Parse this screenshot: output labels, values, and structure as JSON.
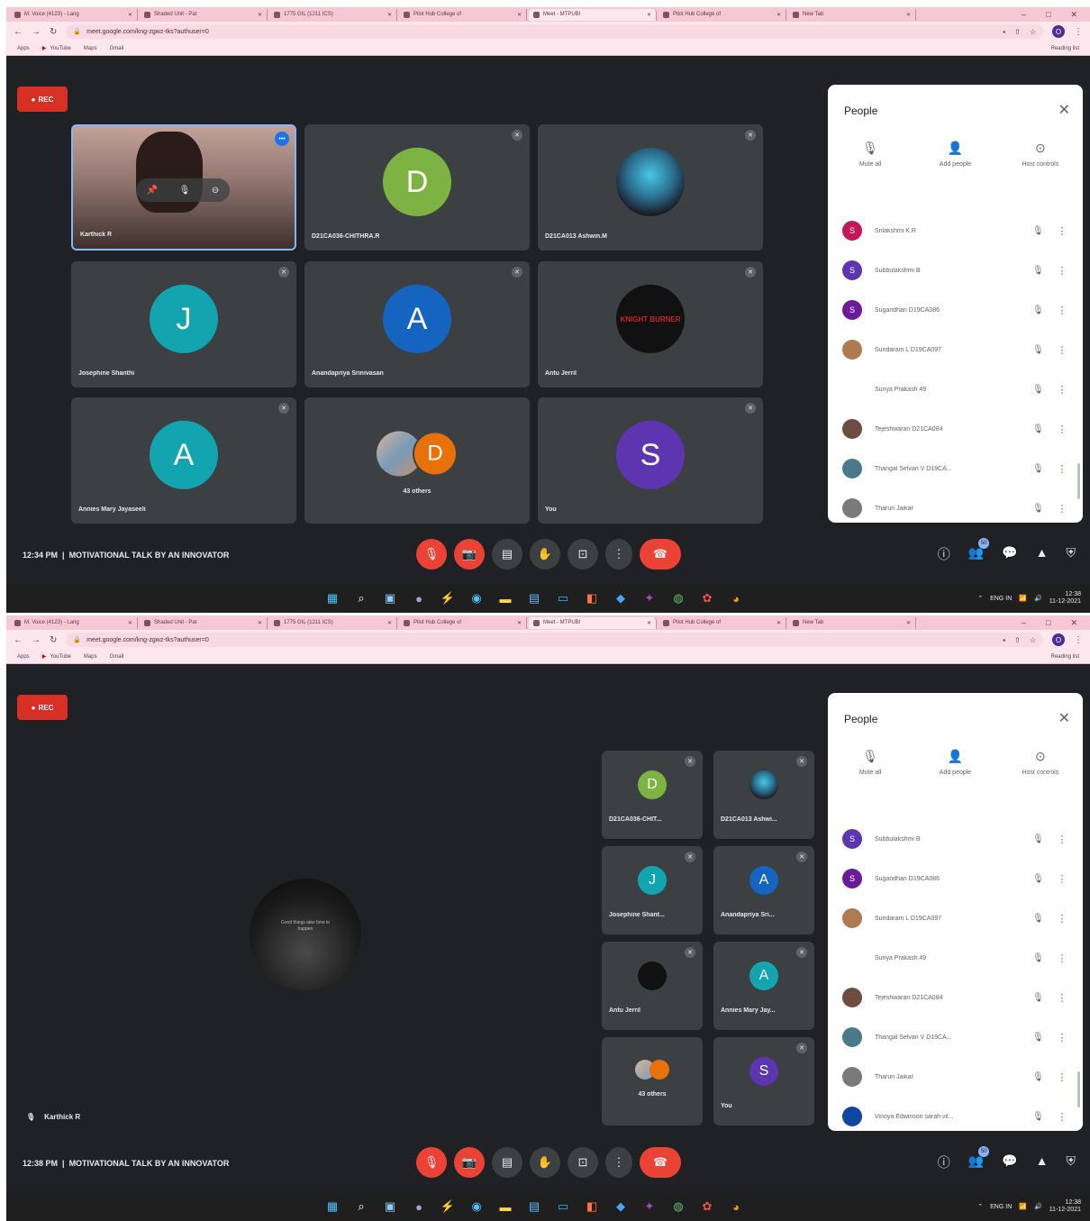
{
  "browser": {
    "tabs": [
      "M. Voice (4123) - Lang",
      "Shaded Unit - Pat",
      "1775 GIL (1211 ICS)",
      "Pilot Hub College of",
      "Meet - MTPUBI",
      "Pilot Hub College of",
      "New Tab"
    ],
    "active_tab_index": 4,
    "url": "meet.google.com/kng-zgwz-tks?authuser=0",
    "profile_initial": "O",
    "bookmarks": [
      "Apps",
      "YouTube",
      "Maps",
      "Gmail"
    ],
    "reading_list": "Reading list",
    "window_controls": [
      "–",
      "□",
      "✕"
    ]
  },
  "meet": {
    "rec_label": "REC",
    "shot1": {
      "time": "12:34 PM",
      "meeting_title": "MOTIVATIONAL TALK BY AN INNOVATOR",
      "tiles": [
        {
          "name": "Karthick R",
          "type": "self"
        },
        {
          "name": "D21CA036-CHITHRA.R",
          "initial": "D",
          "color": "#7cb342"
        },
        {
          "name": "D21CA013 Ashwin.M",
          "type": "photo"
        },
        {
          "name": "Josephine Shanthi",
          "initial": "J",
          "color": "#12a4af"
        },
        {
          "name": "Anandapriya Srinivasan",
          "initial": "A",
          "color": "#1565c0"
        },
        {
          "name": "Antu Jerril",
          "type": "logo",
          "logo_text": "KNIGHT BURNER"
        },
        {
          "name": "Annies Mary Jayaseeli",
          "initial": "A",
          "color": "#12a4af"
        },
        {
          "name": "43 others",
          "type": "others",
          "initial": "D"
        },
        {
          "name": "You",
          "initial": "S",
          "color": "#5e35b1"
        }
      ]
    },
    "shot2": {
      "time": "12:38 PM",
      "meeting_title": "MOTIVATIONAL TALK BY AN INNOVATOR",
      "presenter_name": "Karthick R",
      "presentation_caption": "Good things take time to happen",
      "tiles": [
        {
          "name": "D21CA036-CHIT...",
          "initial": "D",
          "color": "#7cb342"
        },
        {
          "name": "D21CA013 Ashwi...",
          "type": "photo"
        },
        {
          "name": "Josephine Shant...",
          "initial": "J",
          "color": "#12a4af"
        },
        {
          "name": "Anandapriya Sri...",
          "initial": "A",
          "color": "#1565c0"
        },
        {
          "name": "Antu Jerril",
          "type": "logo"
        },
        {
          "name": "Annies Mary Jay...",
          "initial": "A",
          "color": "#12a4af"
        },
        {
          "name": "43 others",
          "type": "others"
        },
        {
          "name": "You",
          "initial": "S",
          "color": "#5e35b1"
        }
      ]
    },
    "people_panel": {
      "title": "People",
      "close": "✕",
      "actions": [
        {
          "label": "Mute all",
          "icon": "mic-off-icon",
          "glyph": "🎙"
        },
        {
          "label": "Add people",
          "icon": "add-person-icon",
          "glyph": "👤"
        },
        {
          "label": "Host controls",
          "icon": "toggle-icon",
          "glyph": "⊙"
        }
      ],
      "shot1_list": [
        {
          "name": "Srilakshmi K.R",
          "initial": "S",
          "color": "#c2185b"
        },
        {
          "name": "Subbulakshmi B",
          "initial": "S",
          "color": "#5e35b1"
        },
        {
          "name": "Sugandhan D19CA086",
          "initial": "S",
          "color": "#6a1b9a"
        },
        {
          "name": "Sundaram L D19CA097",
          "initial": "",
          "color": "#b07a50"
        },
        {
          "name": "Suriya Prakash 49",
          "initial": "",
          "color": "#ffffff"
        },
        {
          "name": "Tejeshwaran D21CA084",
          "initial": "",
          "color": "#6d4c41"
        },
        {
          "name": "Thangal Selvan V D19CA...",
          "initial": "",
          "color": "#4a7a8a"
        },
        {
          "name": "Tharun Jaikar",
          "initial": "",
          "color": "#7a7a7a"
        }
      ],
      "shot2_list": [
        {
          "name": "Subbulakshmi B",
          "initial": "S",
          "color": "#5e35b1"
        },
        {
          "name": "Sugandhan D19CA086",
          "initial": "S",
          "color": "#6a1b9a"
        },
        {
          "name": "Sundaram L D19CA097",
          "initial": "",
          "color": "#b07a50"
        },
        {
          "name": "Suriya Prakash 49",
          "initial": "",
          "color": "#ffffff"
        },
        {
          "name": "Tejeshwaran D21CA084",
          "initial": "",
          "color": "#6d4c41"
        },
        {
          "name": "Thangal Selvan V D19CA...",
          "initial": "",
          "color": "#4a7a8a"
        },
        {
          "name": "Tharun Jaikar",
          "initial": "",
          "color": "#7a7a7a"
        },
        {
          "name": "Vinoya Edwinson sarah vil...",
          "initial": "",
          "color": "#0d47a1"
        }
      ],
      "participant_count": "50"
    },
    "controls": {
      "mic": "🎙",
      "camera": "📷",
      "captions": "▤",
      "hand": "✋",
      "present": "⊡",
      "more": "⋮",
      "end_call": "☎"
    }
  },
  "taskbar": {
    "lang": "ENG IN",
    "clock_time": "12:38",
    "clock_date": "11-12-2021"
  }
}
